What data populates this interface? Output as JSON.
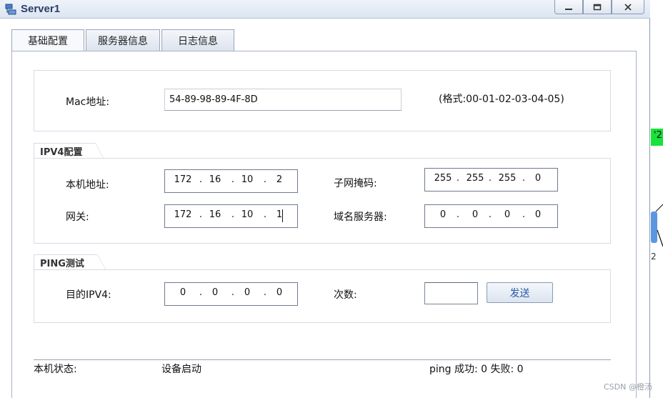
{
  "window": {
    "title": "Server1"
  },
  "tabs": [
    {
      "label": "基础配置"
    },
    {
      "label": "服务器信息"
    },
    {
      "label": "日志信息"
    }
  ],
  "mac": {
    "label": "Mac地址:",
    "value": "54-89-98-89-4F-8D",
    "hint": "(格式:00-01-02-03-04-05)"
  },
  "ipv4": {
    "title": "IPV4配置",
    "local_label": "本机地址:",
    "local_ip": [
      "172",
      "16",
      "10",
      "2"
    ],
    "mask_label": "子网掩码:",
    "mask": [
      "255",
      "255",
      "255",
      "0"
    ],
    "gateway_label": "网关:",
    "gateway": [
      "172",
      "16",
      "10",
      "1"
    ],
    "dns_label": "域名服务器:",
    "dns": [
      "0",
      "0",
      "0",
      "0"
    ]
  },
  "ping": {
    "title": "PING测试",
    "dest_label": "目的IPV4:",
    "dest": [
      "0",
      "0",
      "0",
      "0"
    ],
    "count_label": "次数:",
    "count_value": "",
    "send_label": "发送"
  },
  "status": {
    "label": "本机状态:",
    "value": "设备启动",
    "ping_result": "ping 成功: 0 失败: 0"
  },
  "side": {
    "green_tag": "'2",
    "number": "2"
  },
  "watermark": "CSDN @橙汤"
}
